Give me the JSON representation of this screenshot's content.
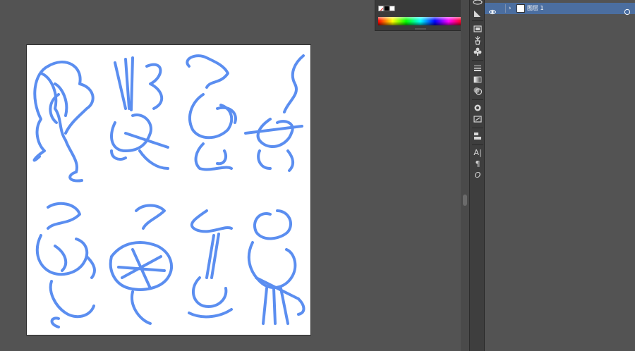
{
  "colors": {
    "canvas_bg": "#535353",
    "artwork_stroke": "#5b8ef0",
    "selected_row": "#4b6ea0"
  },
  "color_panel": {
    "swatches": [
      "none-swatch",
      "black-swatch",
      "white-swatch"
    ],
    "spectrum": "color-spectrum"
  },
  "dock": {
    "icons": [
      "assets-icon",
      "graphic-styles-icon",
      "image-trace-icon",
      "brushes-icon",
      "symbols-icon",
      "stroke-icon",
      "gradient-icon",
      "transparency-icon",
      "appearance-icon",
      "transform-icon",
      "align-icon",
      "character-icon",
      "paragraph-icon",
      "opentype-icon"
    ],
    "glyphs": {
      "character": "A|",
      "paragraph": "¶",
      "opentype": "O"
    }
  },
  "layers": {
    "items": [
      {
        "name": "图层 1",
        "visible": true,
        "expanded": false,
        "selected": true
      }
    ]
  }
}
